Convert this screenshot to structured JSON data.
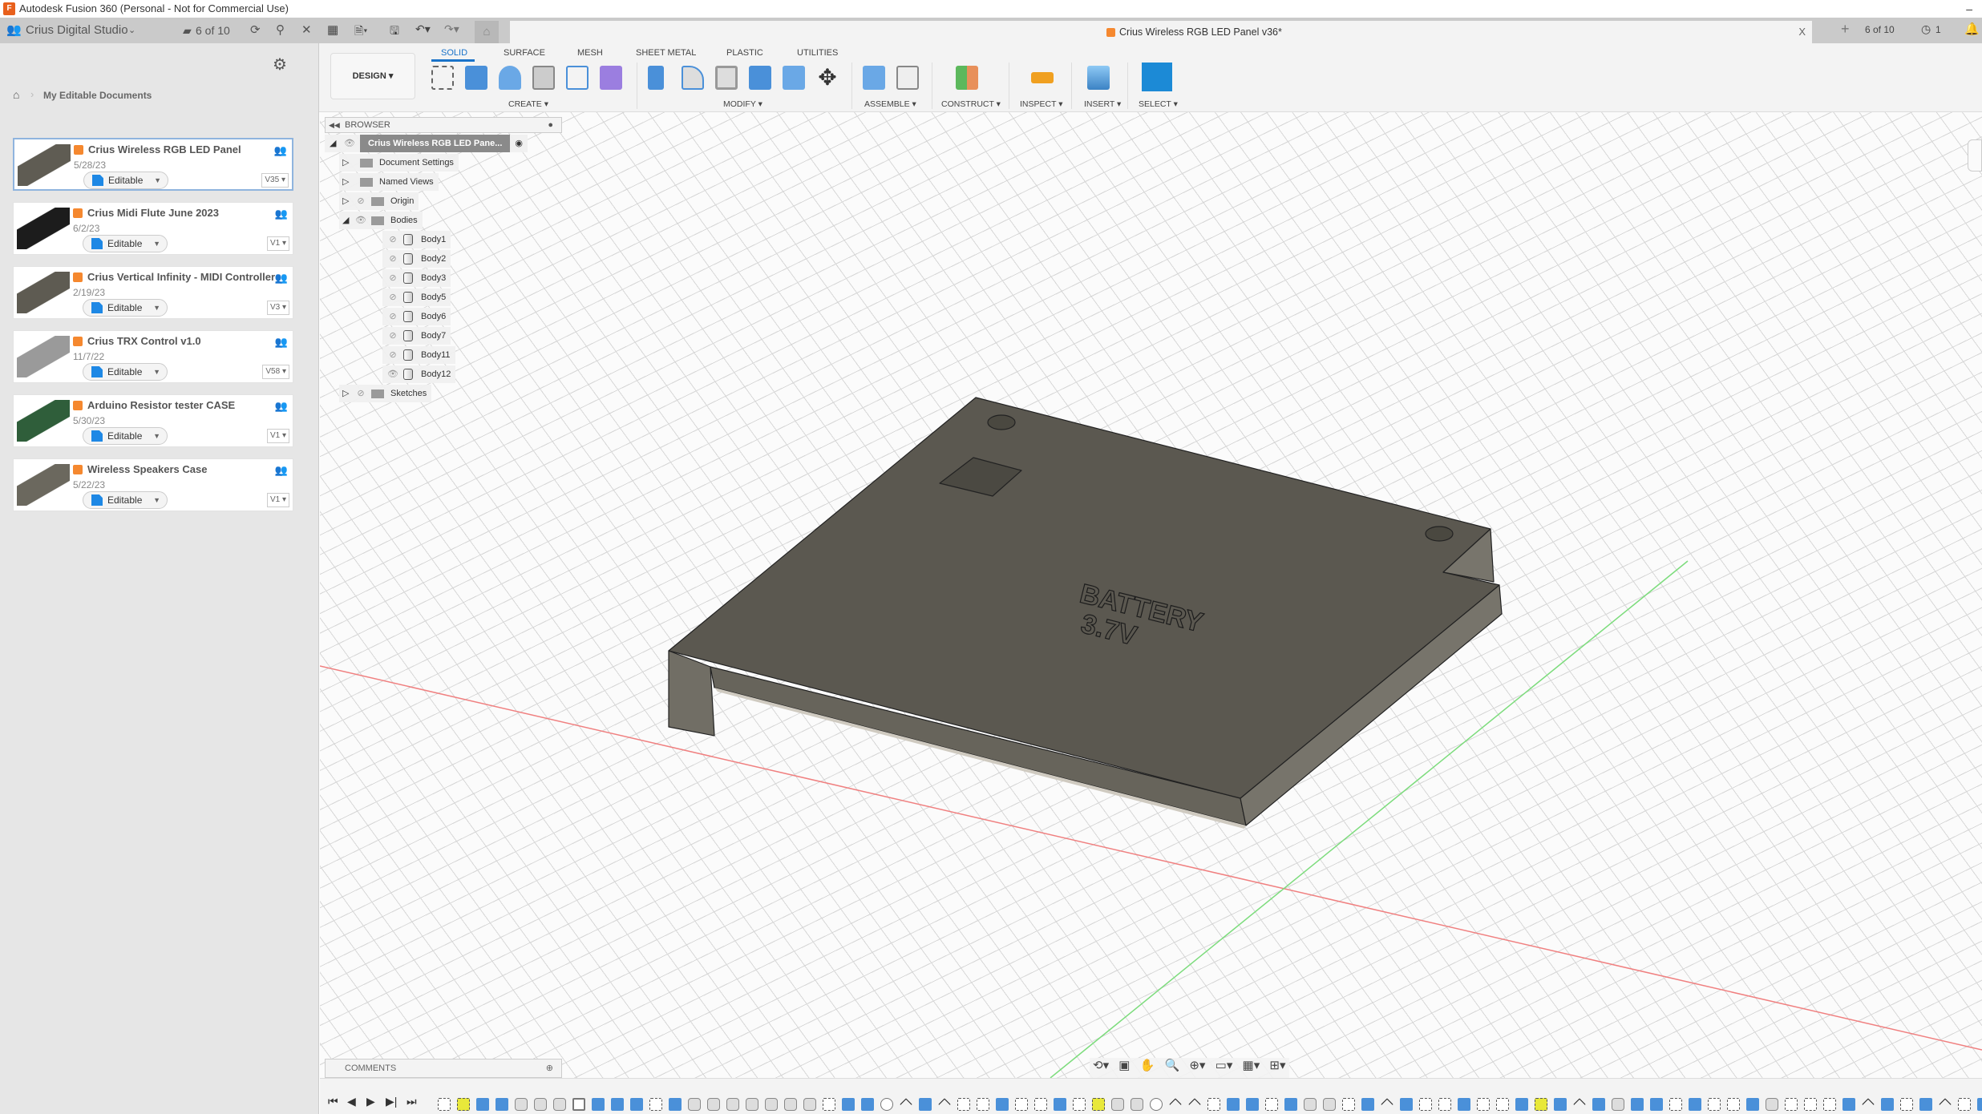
{
  "app": {
    "title": "Autodesk Fusion 360 (Personal - Not for Commercial Use)",
    "logo": "F"
  },
  "data_panel": {
    "team": "Crius Digital Studio",
    "count": "6 of 10",
    "breadcrumb": "My Editable Documents",
    "documents": [
      {
        "name": "Crius Wireless RGB LED Panel",
        "date": "5/28/23",
        "status": "Editable",
        "version": "V35",
        "thumb": "#5f5c53"
      },
      {
        "name": "Crius Midi Flute June 2023",
        "date": "6/2/23",
        "status": "Editable",
        "version": "V1",
        "thumb": "#1c1c1c"
      },
      {
        "name": "Crius Vertical Infinity - MIDI Controller",
        "date": "2/19/23",
        "status": "Editable",
        "version": "V3",
        "thumb": "#5e5b52"
      },
      {
        "name": "Crius TRX Control v1.0",
        "date": "11/7/22",
        "status": "Editable",
        "version": "V58",
        "thumb": "#9a9a9a"
      },
      {
        "name": "Arduino Resistor tester CASE",
        "date": "5/30/23",
        "status": "Editable",
        "version": "V1",
        "thumb": "#2f5e3a"
      },
      {
        "name": "Wireless Speakers Case",
        "date": "5/22/23",
        "status": "Editable",
        "version": "V1",
        "thumb": "#6b685e"
      }
    ]
  },
  "document_tab": {
    "title": "Crius Wireless RGB LED Panel v36*",
    "close": "X",
    "add": "+",
    "jobs": "6 of 10",
    "notifications": "1"
  },
  "toolbar": {
    "workspace": "DESIGN",
    "tabs": [
      "SOLID",
      "SURFACE",
      "MESH",
      "SHEET METAL",
      "PLASTIC",
      "UTILITIES"
    ],
    "groups": [
      "CREATE",
      "MODIFY",
      "ASSEMBLE",
      "CONSTRUCT",
      "INSPECT",
      "INSERT",
      "SELECT"
    ]
  },
  "browser": {
    "title": "BROWSER",
    "root": "Crius Wireless RGB LED Pane...",
    "folders": [
      "Document Settings",
      "Named Views",
      "Origin",
      "Bodies"
    ],
    "bodies": [
      "Body1",
      "Body2",
      "Body3",
      "Body5",
      "Body6",
      "Body7",
      "Body11",
      "Body12"
    ],
    "sketches": "Sketches"
  },
  "model": {
    "label_line1": "BATTERY",
    "label_line2": "3.7V",
    "color": "#5b5850"
  },
  "comments": {
    "title": "COMMENTS"
  },
  "timeline": {
    "features": [
      "sketch",
      "sketch-hl",
      "extrude",
      "extrude",
      "hole",
      "hole",
      "hole",
      "shell",
      "extrude",
      "extrude",
      "extrude",
      "sketch",
      "extrude",
      "hole",
      "hole",
      "hole",
      "hole",
      "hole",
      "hole",
      "hole",
      "sketch",
      "extrude",
      "extrude",
      "joint",
      "move",
      "extrude",
      "move",
      "sketch",
      "sketch",
      "extrude",
      "sketch",
      "sketch",
      "extrude",
      "sketch",
      "sketch-hl",
      "hole",
      "hole",
      "joint",
      "move",
      "move",
      "sketch",
      "extrude",
      "extrude",
      "sketch",
      "extrude",
      "hole",
      "hole",
      "sketch",
      "extrude",
      "move",
      "extrude",
      "sketch",
      "sketch",
      "extrude",
      "sketch",
      "sketch",
      "extrude",
      "sketch-hl",
      "extrude",
      "move",
      "extrude",
      "hole",
      "extrude",
      "extrude",
      "sketch",
      "extrude",
      "sketch",
      "sketch",
      "extrude",
      "hole",
      "sketch",
      "sketch",
      "sketch",
      "extrude",
      "move",
      "extrude",
      "sketch",
      "extrude",
      "move",
      "sketch",
      "extrude",
      "move",
      "sketch",
      "extrude"
    ]
  }
}
